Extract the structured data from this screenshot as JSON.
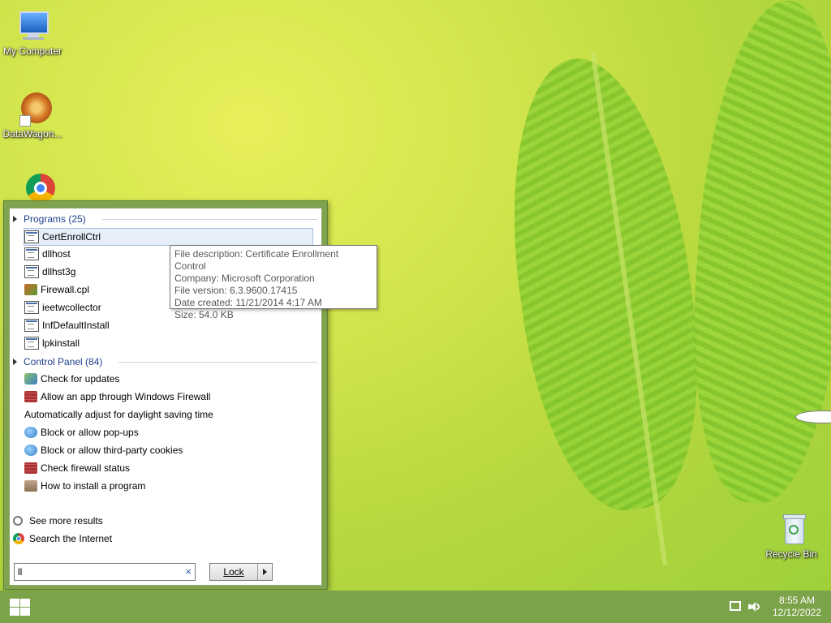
{
  "desktop": {
    "icons": [
      {
        "label": "My Computer",
        "icon": "computer-icon"
      },
      {
        "label": "DataWagon...",
        "icon": "datawagon-icon"
      },
      {
        "label": "",
        "icon": "chrome-icon"
      },
      {
        "label": "Recycle Bin",
        "icon": "recycle-bin-icon"
      }
    ]
  },
  "start_menu": {
    "programs_header": "Programs (25)",
    "programs": [
      {
        "label": "CertEnrollCtrl",
        "icon": "exe-icon"
      },
      {
        "label": "dllhost",
        "icon": "exe-icon"
      },
      {
        "label": "dllhst3g",
        "icon": "exe-icon"
      },
      {
        "label": "Firewall.cpl",
        "icon": "cpl-icon"
      },
      {
        "label": "ieetwcollector",
        "icon": "exe-icon"
      },
      {
        "label": "InfDefaultInstall",
        "icon": "exe-icon"
      },
      {
        "label": "lpkinstall",
        "icon": "exe-icon"
      }
    ],
    "control_panel_header": "Control Panel (84)",
    "control_panel": [
      {
        "label": "Check for updates",
        "icon": "windows-update-icon"
      },
      {
        "label": "Allow an app through Windows Firewall",
        "icon": "firewall-icon"
      },
      {
        "label": "Automatically adjust for daylight saving time",
        "icon": "clock-icon"
      },
      {
        "label": "Block or allow pop-ups",
        "icon": "internet-options-icon"
      },
      {
        "label": "Block or allow third-party cookies",
        "icon": "internet-options-icon"
      },
      {
        "label": "Check firewall status",
        "icon": "firewall-icon"
      },
      {
        "label": "How to install a program",
        "icon": "programs-icon"
      }
    ],
    "see_more": "See more results",
    "search_internet": "Search the Internet",
    "search_value": "ll",
    "clear_glyph": "×",
    "lock_label": "Lock"
  },
  "tooltip": {
    "lines": [
      "File description: Certificate Enrollment Control",
      "Company: Microsoft Corporation",
      "File version: 6.3.9600.17415",
      "Date created: 11/21/2014 4:17 AM",
      "Size: 54.0 KB"
    ]
  },
  "taskbar": {
    "time": "8:55 AM",
    "date": "12/12/2022"
  }
}
